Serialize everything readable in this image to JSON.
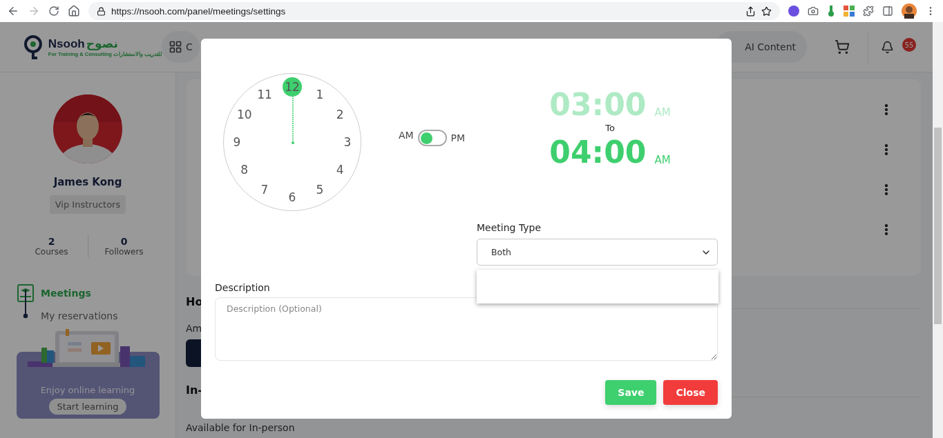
{
  "browser": {
    "url": "https://nsooh.com/panel/meetings/settings"
  },
  "header": {
    "logo": {
      "name": "Nsooh",
      "arabic_name": "نصوح",
      "tagline": "For Training & Consulting",
      "arabic_tagline": "للتدريب والاستشارات"
    },
    "menu_button": "C",
    "ai_button": "AI Content",
    "notifications_count": "55"
  },
  "profile": {
    "name": "James Kong",
    "badge": "Vip Instructors",
    "stats": [
      {
        "value": "2",
        "label": "Courses"
      },
      {
        "value": "0",
        "label": "Followers"
      }
    ]
  },
  "nav": [
    {
      "label": "Meetings",
      "selected": true
    },
    {
      "label": "My reservations",
      "selected": false
    }
  ],
  "promo": {
    "text": "Enjoy online learning",
    "button": "Start learning"
  },
  "content": {
    "menu_rows": [
      {
        "kind": "row"
      },
      {
        "kind": "row"
      },
      {
        "kind": "row"
      },
      {
        "kind": "row"
      }
    ],
    "heading": "Ho",
    "amount_label": "Am",
    "second_heading": "In-",
    "inperson_label": "Available for In-person"
  },
  "modal": {
    "clock": {
      "hours": [
        {
          "label": "12",
          "selected": true
        },
        {
          "label": "1",
          "selected": false
        },
        {
          "label": "2",
          "selected": false
        },
        {
          "label": "3",
          "selected": false
        },
        {
          "label": "4",
          "selected": false
        },
        {
          "label": "5",
          "selected": false
        },
        {
          "label": "6",
          "selected": false
        },
        {
          "label": "7",
          "selected": false
        },
        {
          "label": "8",
          "selected": false
        },
        {
          "label": "9",
          "selected": false
        },
        {
          "label": "10",
          "selected": false
        },
        {
          "label": "11",
          "selected": false
        }
      ]
    },
    "period": {
      "left": "AM",
      "right": "PM",
      "on": false
    },
    "times": [
      {
        "time": "03:00",
        "period": "AM",
        "selected": false
      },
      {
        "time": "04:00",
        "period": "AM",
        "selected": true
      }
    ],
    "separator": "To",
    "meeting_type": {
      "label": "Meeting Type",
      "value": "Both",
      "expanded": true
    },
    "description": {
      "label": "Description",
      "placeholder": "Description (Optional)"
    },
    "buttons": [
      {
        "label": "Save",
        "kind": "primary"
      },
      {
        "label": "Close",
        "kind": "danger"
      }
    ]
  }
}
